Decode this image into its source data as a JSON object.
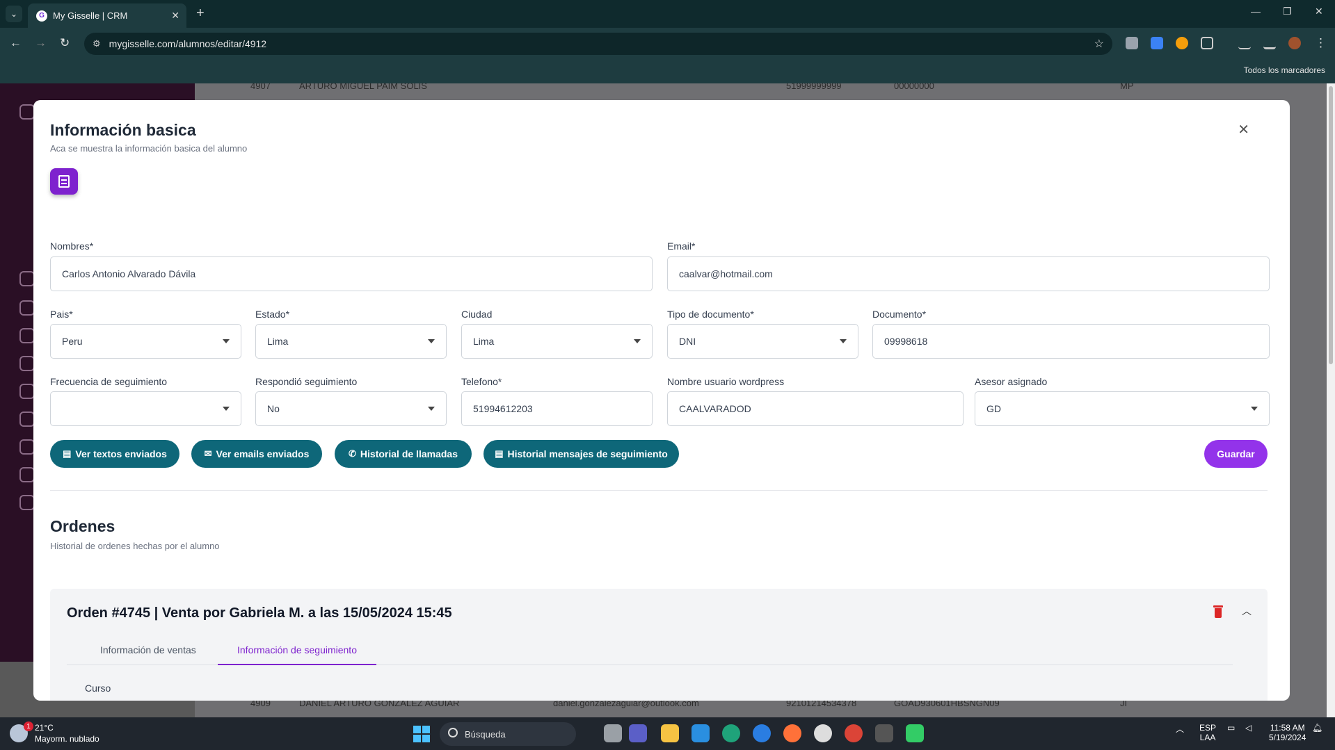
{
  "browser": {
    "tab_title": "My Gisselle | CRM",
    "favicon_letter": "G",
    "url": "mygisselle.com/alumnos/editar/4912",
    "bookmarks_label": "Todos los marcadores"
  },
  "background_rows": [
    {
      "id": "4907",
      "name": "ARTURO MIGUEL PAIM SOLIS",
      "email": "",
      "phone": "51999999999",
      "code": "00000000",
      "assigned": "MP"
    },
    {
      "id": "4909",
      "name": "DANIEL ARTURO GONZALEZ AGUIAR",
      "email": "daniel.gonzalezaguiar@outlook.com",
      "phone": "92101214534378",
      "code": "GOAD930601HBSNGN09",
      "assigned": "JI"
    }
  ],
  "modal": {
    "title": "Información basica",
    "subtitle": "Aca se muestra la información basica del alumno",
    "fields": {
      "nombres": {
        "label": "Nombres*",
        "value": "Carlos Antonio Alvarado Dávila"
      },
      "email": {
        "label": "Email*",
        "value": "caalvar@hotmail.com"
      },
      "pais": {
        "label": "Pais*",
        "value": "Peru"
      },
      "estado": {
        "label": "Estado*",
        "value": "Lima"
      },
      "ciudad": {
        "label": "Ciudad",
        "value": "Lima"
      },
      "tipo_documento": {
        "label": "Tipo de documento*",
        "value": "DNI"
      },
      "documento": {
        "label": "Documento*",
        "value": "09998618"
      },
      "frecuencia": {
        "label": "Frecuencia de seguimiento",
        "value": ""
      },
      "respondio": {
        "label": "Respondió seguimiento",
        "value": "No"
      },
      "telefono": {
        "label": "Telefono*",
        "value": "51994612203"
      },
      "usuario_wp": {
        "label": "Nombre usuario wordpress",
        "value": "CAALVARADOD"
      },
      "asesor": {
        "label": "Asesor asignado",
        "value": "GD"
      }
    },
    "buttons": {
      "textos": "Ver textos enviados",
      "emails": "Ver emails enviados",
      "llamadas": "Historial de llamadas",
      "mensajes": "Historial mensajes de seguimiento",
      "guardar": "Guardar"
    },
    "orders": {
      "title": "Ordenes",
      "subtitle": "Historial de ordenes hechas por el alumno",
      "order_title": "Orden #4745 | Venta por Gabriela M. a las 15/05/2024 15:45",
      "tabs": [
        "Información de ventas",
        "Información de seguimiento"
      ],
      "active_tab": 1,
      "section_label": "Curso"
    }
  },
  "taskbar": {
    "temp": "21°C",
    "weather": "Mayorm. nublado",
    "weather_badge": "1",
    "search_label": "Búsqueda",
    "lang": "ESP",
    "lang2": "LAA",
    "time": "11:58 AM",
    "date": "5/19/2024"
  },
  "colors": {
    "primary": "#9333ea",
    "teal": "#0e6779",
    "danger": "#dc2626"
  }
}
